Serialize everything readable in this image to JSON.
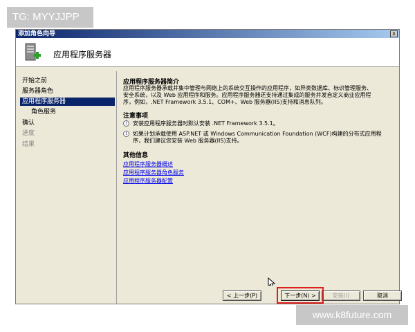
{
  "badge": {
    "text": "TG: MYYJJPP"
  },
  "window": {
    "title": "添加角色向导",
    "close_label": "x"
  },
  "header": {
    "title": "应用程序服务器",
    "icon": "server-add-icon"
  },
  "sidebar": {
    "items": [
      {
        "label": "开始之前",
        "state": "normal"
      },
      {
        "label": "服务器角色",
        "state": "normal"
      },
      {
        "label": "应用程序服务器",
        "state": "active"
      },
      {
        "label": "角色服务",
        "state": "normal"
      },
      {
        "label": "确认",
        "state": "normal"
      },
      {
        "label": "进度",
        "state": "disabled"
      },
      {
        "label": "结果",
        "state": "disabled"
      }
    ]
  },
  "content": {
    "intro_heading": "应用程序服务器简介",
    "intro_line1": "应用程序服务器承载并集中管理与网络上的系统交互操作的应用程序，如异类数据库、标识管理服务、",
    "intro_line2": "安全系统，以及 Web 应用程序和服务。应用程序服务器还支持通过集成的服务并发自定义商业应用程",
    "intro_line3": "序，例如，.NET Framework 3.5.1、COM+、Web 服务器(IIS)支持和消息队列。",
    "notes_heading": "注意事项",
    "notes": [
      {
        "line1": "安装应用程序服务器时默认安装 .NET Framework 3.5.1。",
        "line2": ""
      },
      {
        "line1": "如果计划承载使用 ASP.NET 或 Windows Communication Foundation (WCF)构建的分布式应用程",
        "line2": "序，我们建议您安装 Web 服务器(IIS)支持。"
      }
    ],
    "more_heading": "其他信息",
    "links": [
      "应用程序服务器概述",
      "应用程序服务器角色服务",
      "应用程序服务器配置"
    ]
  },
  "buttons": {
    "prev": "< 上一步(P)",
    "next": "下一步(N) >",
    "install": "安装(I)",
    "cancel": "取消"
  },
  "watermark": {
    "text": "www.k8future.com"
  },
  "colors": {
    "title_bar_start": "#0a246a",
    "title_bar_end": "#a6caf0",
    "active_nav": "#0a246a",
    "link": "#0000ee",
    "highlight": "#e02020"
  }
}
